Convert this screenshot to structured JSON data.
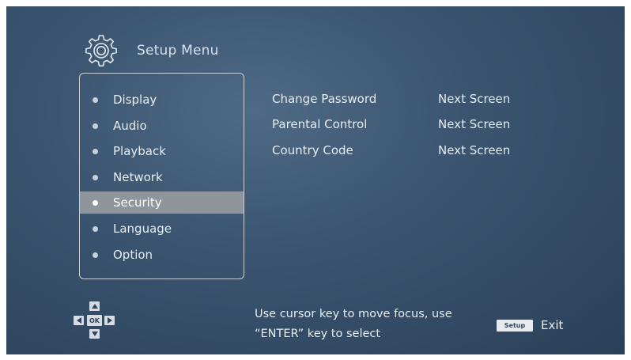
{
  "header": {
    "title": "Setup Menu",
    "icon": "gear-icon"
  },
  "menu": {
    "items": [
      {
        "label": "Display",
        "selected": false
      },
      {
        "label": "Audio",
        "selected": false
      },
      {
        "label": "Playback",
        "selected": false
      },
      {
        "label": "Network",
        "selected": false
      },
      {
        "label": "Security",
        "selected": true
      },
      {
        "label": "Language",
        "selected": false
      },
      {
        "label": "Option",
        "selected": false
      }
    ]
  },
  "options": [
    {
      "name": "Change Password",
      "value": "Next Screen"
    },
    {
      "name": "Parental Control",
      "value": "Next Screen"
    },
    {
      "name": "Country Code",
      "value": "Next Screen"
    }
  ],
  "footer": {
    "dpad_ok_label": "OK",
    "help_line1": "Use cursor key to move focus, use",
    "help_line2": "“ENTER” key to select",
    "setup_key_label": "Setup",
    "exit_label": "Exit"
  },
  "colors": {
    "background": "#3b5570",
    "selection": "#8f959b",
    "text": "#e8edf2"
  }
}
